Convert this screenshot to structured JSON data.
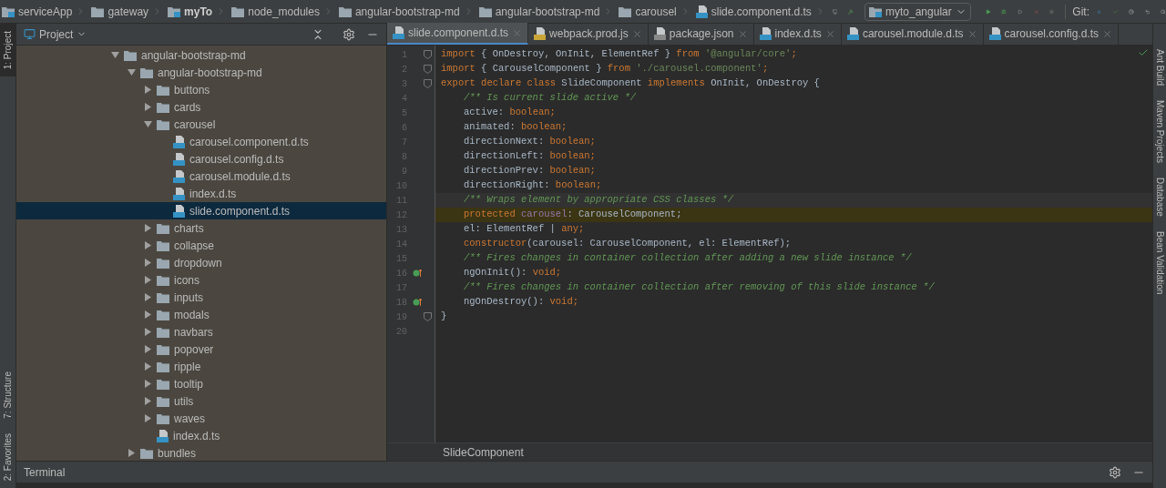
{
  "breadcrumbs": [
    {
      "label": "serviceApp",
      "kind": "module",
      "bold": false
    },
    {
      "label": "gateway",
      "kind": "folder",
      "bold": false
    },
    {
      "label": "myTo",
      "kind": "module",
      "bold": true
    },
    {
      "label": "node_modules",
      "kind": "folder",
      "bold": false
    },
    {
      "label": "angular-bootstrap-md",
      "kind": "folder",
      "bold": false
    },
    {
      "label": "angular-bootstrap-md",
      "kind": "folder",
      "bold": false
    },
    {
      "label": "carousel",
      "kind": "folder",
      "bold": false
    },
    {
      "label": "slide.component.d.ts",
      "kind": "ts",
      "bold": false
    }
  ],
  "toolbar": {
    "run_config": "myto_angular",
    "vcs_label": "Git:"
  },
  "left_tool_strip": {
    "top": [
      {
        "label": "1: Project",
        "selected": true
      }
    ],
    "bottom": [
      {
        "label": "7: Structure",
        "selected": false
      },
      {
        "label": "2: Favorites",
        "selected": false
      }
    ]
  },
  "project_panel": {
    "title": "Project",
    "tree": [
      {
        "label": "angular-bootstrap-md",
        "kind": "folder",
        "expanded": true,
        "selected": false,
        "children": [
          {
            "label": "angular-bootstrap-md",
            "kind": "folder",
            "expanded": true,
            "selected": false,
            "children": [
              {
                "label": "buttons",
                "kind": "folder",
                "expanded": false,
                "selected": false
              },
              {
                "label": "cards",
                "kind": "folder",
                "expanded": false,
                "selected": false
              },
              {
                "label": "carousel",
                "kind": "folder",
                "expanded": true,
                "selected": false,
                "children": [
                  {
                    "label": "carousel.component.d.ts",
                    "kind": "ts",
                    "selected": false
                  },
                  {
                    "label": "carousel.config.d.ts",
                    "kind": "ts",
                    "selected": false
                  },
                  {
                    "label": "carousel.module.d.ts",
                    "kind": "ts",
                    "selected": false
                  },
                  {
                    "label": "index.d.ts",
                    "kind": "ts",
                    "selected": false
                  },
                  {
                    "label": "slide.component.d.ts",
                    "kind": "ts",
                    "selected": true
                  }
                ]
              },
              {
                "label": "charts",
                "kind": "folder",
                "expanded": false,
                "selected": false
              },
              {
                "label": "collapse",
                "kind": "folder",
                "expanded": false,
                "selected": false
              },
              {
                "label": "dropdown",
                "kind": "folder",
                "expanded": false,
                "selected": false
              },
              {
                "label": "icons",
                "kind": "folder",
                "expanded": false,
                "selected": false
              },
              {
                "label": "inputs",
                "kind": "folder",
                "expanded": false,
                "selected": false
              },
              {
                "label": "modals",
                "kind": "folder",
                "expanded": false,
                "selected": false
              },
              {
                "label": "navbars",
                "kind": "folder",
                "expanded": false,
                "selected": false
              },
              {
                "label": "popover",
                "kind": "folder",
                "expanded": false,
                "selected": false
              },
              {
                "label": "ripple",
                "kind": "folder",
                "expanded": false,
                "selected": false
              },
              {
                "label": "tooltip",
                "kind": "folder",
                "expanded": false,
                "selected": false
              },
              {
                "label": "utils",
                "kind": "folder",
                "expanded": false,
                "selected": false
              },
              {
                "label": "waves",
                "kind": "folder",
                "expanded": false,
                "selected": false
              },
              {
                "label": "index.d.ts",
                "kind": "ts",
                "selected": false
              }
            ]
          },
          {
            "label": "bundles",
            "kind": "folder",
            "expanded": false,
            "selected": false
          }
        ]
      }
    ]
  },
  "editor": {
    "tabs": [
      {
        "label": "slide.component.d.ts",
        "kind": "ts",
        "selected": true
      },
      {
        "label": "webpack.prod.js",
        "kind": "js",
        "selected": false
      },
      {
        "label": "package.json",
        "kind": "json",
        "selected": false
      },
      {
        "label": "index.d.ts",
        "kind": "ts",
        "selected": false
      },
      {
        "label": "carousel.module.d.ts",
        "kind": "ts",
        "selected": false
      },
      {
        "label": "carousel.config.d.ts",
        "kind": "ts",
        "selected": false
      }
    ],
    "lines": [
      {
        "number": "1",
        "kind": "normal",
        "fold": true,
        "override_mark": false,
        "indented": false,
        "tokens": [
          {
            "keyword": "import"
          },
          {
            "plain": " { OnDestroy, OnInit, ElementRef } "
          },
          {
            "keyword": "from"
          },
          {
            "string": " '@angular/core'"
          },
          {
            "keyword": ";"
          }
        ]
      },
      {
        "number": "2",
        "kind": "normal",
        "fold": true,
        "override_mark": false,
        "indented": false,
        "tokens": [
          {
            "keyword": "import"
          },
          {
            "plain": " { CarouselComponent } "
          },
          {
            "keyword": "from"
          },
          {
            "string": " './carousel.component'"
          },
          {
            "keyword": ";"
          }
        ]
      },
      {
        "number": "3",
        "kind": "normal",
        "fold": true,
        "override_mark": false,
        "indented": false,
        "tokens": [
          {
            "keyword": "export declare class"
          },
          {
            "plain": " SlideComponent "
          },
          {
            "keyword": "implements"
          },
          {
            "plain": " OnInit, OnDestroy {"
          }
        ]
      },
      {
        "number": "4",
        "kind": "normal",
        "fold": false,
        "override_mark": false,
        "indented": true,
        "tokens": [
          {
            "comment": "/** Is current slide active */"
          }
        ]
      },
      {
        "number": "5",
        "kind": "normal",
        "fold": false,
        "override_mark": false,
        "indented": true,
        "tokens": [
          {
            "plain": "active: "
          },
          {
            "keyword": "boolean;"
          }
        ]
      },
      {
        "number": "6",
        "kind": "normal",
        "fold": false,
        "override_mark": false,
        "indented": true,
        "tokens": [
          {
            "plain": "animated: "
          },
          {
            "keyword": "boolean;"
          }
        ]
      },
      {
        "number": "7",
        "kind": "normal",
        "fold": false,
        "override_mark": false,
        "indented": true,
        "tokens": [
          {
            "plain": "directionNext: "
          },
          {
            "keyword": "boolean;"
          }
        ]
      },
      {
        "number": "8",
        "kind": "normal",
        "fold": false,
        "override_mark": false,
        "indented": true,
        "tokens": [
          {
            "plain": "directionLeft: "
          },
          {
            "keyword": "boolean;"
          }
        ]
      },
      {
        "number": "9",
        "kind": "normal",
        "fold": false,
        "override_mark": false,
        "indented": true,
        "tokens": [
          {
            "plain": "directionPrev: "
          },
          {
            "keyword": "boolean;"
          }
        ]
      },
      {
        "number": "10",
        "kind": "normal",
        "fold": false,
        "override_mark": false,
        "indented": true,
        "tokens": [
          {
            "plain": "directionRight: "
          },
          {
            "keyword": "boolean;"
          }
        ]
      },
      {
        "number": "11",
        "kind": "current",
        "fold": false,
        "override_mark": false,
        "indented": true,
        "tokens": [
          {
            "comment": "/** Wraps element by appropriate CSS classes */"
          }
        ]
      },
      {
        "number": "12",
        "kind": "highlight",
        "fold": false,
        "override_mark": false,
        "indented": true,
        "tokens": [
          {
            "keyword": "protected"
          },
          {
            "field": " carousel"
          },
          {
            "plain": ": CarouselComponent;"
          }
        ]
      },
      {
        "number": "13",
        "kind": "normal",
        "fold": false,
        "override_mark": false,
        "indented": true,
        "tokens": [
          {
            "plain": "el: ElementRef | "
          },
          {
            "keyword": "any;"
          }
        ]
      },
      {
        "number": "14",
        "kind": "normal",
        "fold": false,
        "override_mark": false,
        "indented": true,
        "tokens": [
          {
            "keyword": "constructor"
          },
          {
            "plain": "(carousel: CarouselComponent, el: ElementRef);"
          }
        ]
      },
      {
        "number": "15",
        "kind": "normal",
        "fold": false,
        "override_mark": false,
        "indented": true,
        "tokens": [
          {
            "comment": "/** Fires changes in container collection after adding a new slide instance */"
          }
        ]
      },
      {
        "number": "16",
        "kind": "normal",
        "fold": false,
        "override_mark": true,
        "indented": true,
        "tokens": [
          {
            "plain": "ngOnInit(): "
          },
          {
            "keyword": "void;"
          }
        ]
      },
      {
        "number": "17",
        "kind": "normal",
        "fold": false,
        "override_mark": false,
        "indented": true,
        "tokens": [
          {
            "comment": "/** Fires changes in container collection after removing of this slide instance */"
          }
        ]
      },
      {
        "number": "18",
        "kind": "normal",
        "fold": false,
        "override_mark": true,
        "indented": true,
        "tokens": [
          {
            "plain": "ngOnDestroy(): "
          },
          {
            "keyword": "void;"
          }
        ]
      },
      {
        "number": "19",
        "kind": "normal",
        "fold": true,
        "override_mark": false,
        "indented": false,
        "tokens": [
          {
            "plain": "}"
          }
        ]
      },
      {
        "number": "20",
        "kind": "normal",
        "fold": false,
        "override_mark": false
      }
    ],
    "breadcrumb": "SlideComponent"
  },
  "right_tool_strip": [
    {
      "label": "Ant Build"
    },
    {
      "label": "Maven Projects"
    },
    {
      "label": "Database"
    },
    {
      "label": "Bean Validation"
    }
  ],
  "bottom_bar": {
    "title": "Terminal"
  }
}
